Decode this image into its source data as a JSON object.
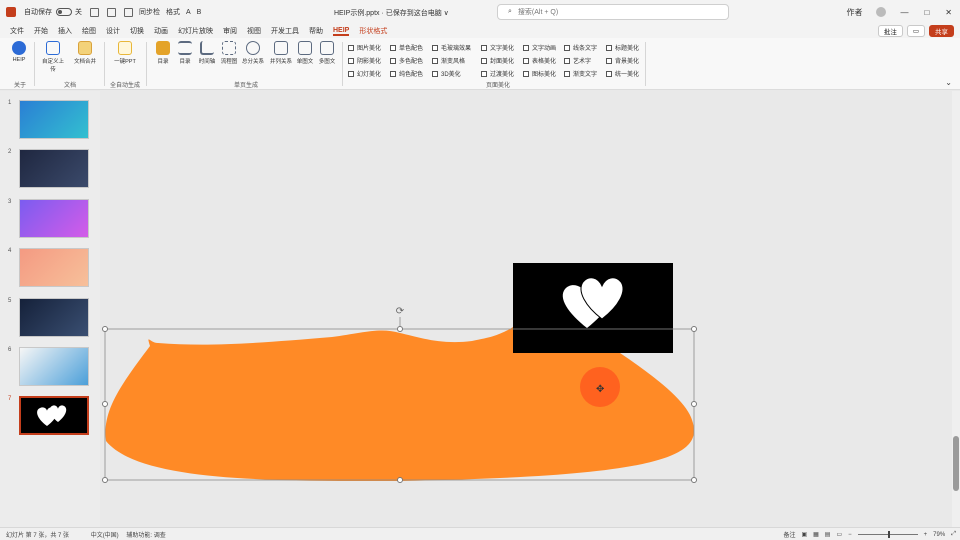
{
  "titlebar": {
    "autosave": "自动保存",
    "toggle_state": "关",
    "quick": [
      "同步检",
      "格式",
      "A",
      "B"
    ],
    "doc_title": "HEIP示例.pptx · 已保存到这台电脑 ∨",
    "search_placeholder": "搜索(Alt + Q)",
    "user": "作者",
    "window_min": "—",
    "window_max": "□",
    "window_close": "✕"
  },
  "menu": {
    "tabs": [
      "文件",
      "开始",
      "插入",
      "绘图",
      "设计",
      "切换",
      "动画",
      "幻灯片放映",
      "审阅",
      "视图",
      "开发工具",
      "帮助",
      "HEIP",
      "形状格式"
    ],
    "active": "HEIP",
    "comment": "批注",
    "share": "共享"
  },
  "ribbon": {
    "big_buttons": [
      {
        "label": "HEIP",
        "color": "#2c6bd6"
      },
      {
        "label": "自定义上传",
        "color": "#2c6bd6"
      },
      {
        "label": "文档合并",
        "color": "#d9a23b"
      },
      {
        "label": "一键PPT",
        "color": "#e8b73a"
      },
      {
        "label": "目录",
        "color": "#e4a329"
      },
      {
        "label": "目录",
        "color": "#5d6b80"
      },
      {
        "label": "时间轴",
        "color": "#5d6b80"
      },
      {
        "label": "流程图",
        "color": "#5d6b80"
      },
      {
        "label": "总分关系",
        "color": "#5d6b80"
      },
      {
        "label": "并列关系",
        "color": "#5d6b80"
      },
      {
        "label": "单图文",
        "color": "#5d6b80"
      },
      {
        "label": "多图文",
        "color": "#5d6b80"
      }
    ],
    "groups": [
      "关于",
      "文档",
      "全自动生成",
      "单页生成",
      "页面美化"
    ],
    "checkboxes": [
      [
        "图片美化",
        "单色配色",
        "毛玻璃效果",
        "文字美化",
        "文字动画",
        "线条文字",
        "标题美化"
      ],
      [
        "阴影美化",
        "多色配色",
        "渐变风格",
        "封面美化",
        "表格美化",
        "艺术字",
        "背景美化"
      ],
      [
        "幻灯美化",
        "纯色配色",
        "3D美化",
        "过渡美化",
        "图标美化",
        "渐变文字",
        "统一美化"
      ]
    ]
  },
  "thumbnails": [
    {
      "num": "1",
      "bg": "#2a7fd4",
      "bg2": "#33c0d0"
    },
    {
      "num": "2",
      "bg": "#1f2740",
      "bg2": "#3b4a6b"
    },
    {
      "num": "3",
      "bg": "#7b5cf0",
      "bg2": "#d45ce8"
    },
    {
      "num": "4",
      "bg": "#f49a82",
      "bg2": "#f7c09a"
    },
    {
      "num": "5",
      "bg": "#15213a",
      "bg2": "#3a4f72"
    },
    {
      "num": "6",
      "bg": "#f6f6f6",
      "bg2": "#4b9fd9"
    },
    {
      "num": "7",
      "bg": "#000000",
      "bg2": "#000000"
    }
  ],
  "slide": {
    "shape_color": "#ff8a26",
    "heart_panel_color": "#000000",
    "heart_color": "#ffffff"
  },
  "status": {
    "left": [
      "幻灯片 第 7 张，共 7 张",
      "中文(中国)",
      "辅助功能: 调查"
    ],
    "notes": "备注",
    "zoom": "79%"
  },
  "colors": {
    "accent": "#c43e1c",
    "cursor_highlight": "#ff5a1f"
  }
}
